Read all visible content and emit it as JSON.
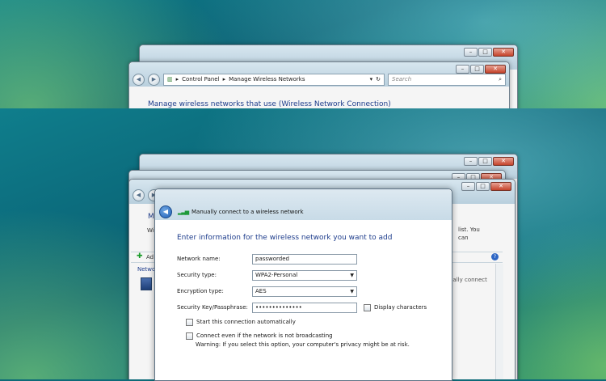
{
  "explorer": {
    "breadcrumb": [
      "Control Panel",
      "Manage Wireless Networks"
    ],
    "search_placeholder": "Search",
    "manage_heading": "Manage wireless networks that use (Wireless Network Connection)",
    "fragment_m": "M",
    "fragment_w": "Wi",
    "fragment_add": "Ad",
    "fragment_netw": "Netwo",
    "right_text_list": "list. You",
    "right_text_can": "can",
    "right_text_connect": "ually connect"
  },
  "caption": {
    "minimize": "–",
    "maximize": "□",
    "close": "✕"
  },
  "nav": {
    "back": "◀",
    "forward": "▶",
    "go": "↻",
    "dropdown": "▾",
    "search_glyph": "⌕"
  },
  "dialog": {
    "title": "Manually connect to a wireless network",
    "heading": "Enter information for the wireless network you want to add",
    "network_name_label": "Network name:",
    "network_name_value": "passworded",
    "security_type_label": "Security type:",
    "security_type_value": "WPA2-Personal",
    "encryption_type_label": "Encryption type:",
    "encryption_type_value": "AES",
    "passphrase_label": "Security Key/Passphrase:",
    "passphrase_value": "••••••••••••••",
    "display_characters_label": "Display characters",
    "start_auto_label": "Start this connection automatically",
    "connect_hidden_label": "Connect even if the network is not broadcasting",
    "warning_text": "Warning: If you select this option, your computer's privacy might be at risk."
  },
  "icons": {
    "back": "back-arrow-icon",
    "signal": "signal-bars-icon",
    "info": "info-icon"
  }
}
